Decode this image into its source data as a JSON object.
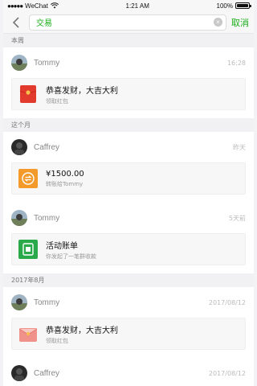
{
  "status_bar": {
    "carrier": "WeChat",
    "time": "1:21 AM",
    "battery": "100%"
  },
  "search": {
    "query": "交易",
    "cancel_label": "取消"
  },
  "sections": [
    {
      "header": "本周",
      "entries": [
        {
          "name": "Tommy",
          "time": "16:28",
          "card_title": "恭喜发财，大吉大利",
          "card_sub": "领取红包",
          "icon": "red-packet-icon"
        }
      ]
    },
    {
      "header": "这个月",
      "entries": [
        {
          "name": "Caffrey",
          "time": "昨天",
          "card_title": "¥1500.00",
          "card_sub": "转账给Tommy",
          "icon": "transfer-icon"
        },
        {
          "name": "Tommy",
          "time": "5天前",
          "card_title": "活动账单",
          "card_sub": "你发起了一笔群收款",
          "icon": "group-bill-icon"
        }
      ]
    },
    {
      "header": "2017年8月",
      "entries": [
        {
          "name": "Tommy",
          "time": "2017/08/12",
          "card_title": "恭喜发财，大吉大利",
          "card_sub": "领取红包",
          "icon": "red-packet-open-icon"
        },
        {
          "name": "Caffrey",
          "time": "2017/08/12"
        }
      ]
    }
  ],
  "colors": {
    "accent": "#1aad19",
    "red_packet": "#e23b2e",
    "transfer": "#f39a2b",
    "group_bill": "#2aa94a"
  }
}
